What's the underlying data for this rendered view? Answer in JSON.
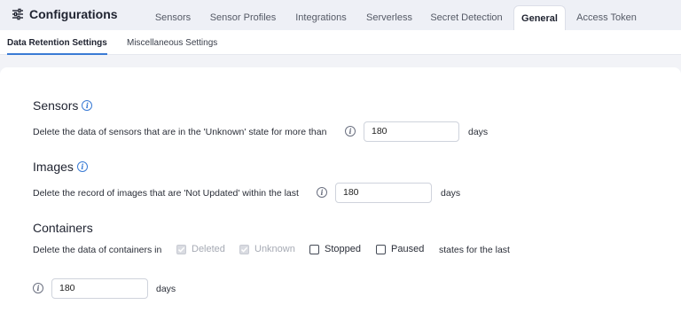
{
  "header": {
    "title": "Configurations",
    "icon": "sliders-icon",
    "tabs": [
      {
        "label": "Sensors"
      },
      {
        "label": "Sensor Profiles"
      },
      {
        "label": "Integrations"
      },
      {
        "label": "Serverless"
      },
      {
        "label": "Secret Detection"
      },
      {
        "label": "General"
      },
      {
        "label": "Access Token"
      }
    ],
    "active_tab": "General"
  },
  "subtabs": [
    {
      "label": "Data Retention Settings"
    },
    {
      "label": "Miscellaneous Settings"
    }
  ],
  "active_subtab": "Data Retention Settings",
  "accent_color": "#3a7bd5",
  "sensors": {
    "title": "Sensors",
    "description": "Delete the data of sensors that are in the 'Unknown' state for more than",
    "value": "180",
    "unit": "days"
  },
  "images": {
    "title": "Images",
    "description": "Delete the record of images that are 'Not Updated' within the last",
    "value": "180",
    "unit": "days"
  },
  "containers": {
    "title": "Containers",
    "description": "Delete the data of containers in",
    "states": [
      {
        "label": "Deleted",
        "checked": true,
        "disabled": true
      },
      {
        "label": "Unknown",
        "checked": true,
        "disabled": true
      },
      {
        "label": "Stopped",
        "checked": false,
        "disabled": false
      },
      {
        "label": "Paused",
        "checked": false,
        "disabled": false
      }
    ],
    "suffix": "states for the last",
    "value": "180",
    "unit": "days"
  }
}
